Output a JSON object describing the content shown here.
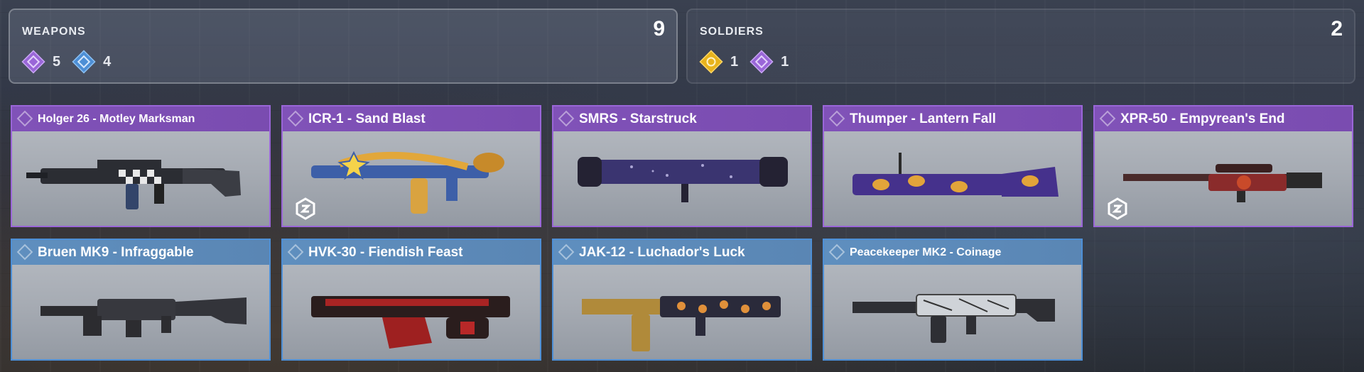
{
  "weapons": {
    "title": "WEAPONS",
    "total": "9",
    "counts": [
      {
        "icon": "epic-rarity-icon",
        "value": "5",
        "color": "#9a66d8"
      },
      {
        "icon": "rare-rarity-icon",
        "value": "4",
        "color": "#4d8fd6"
      }
    ]
  },
  "soldiers": {
    "title": "SOLDIERS",
    "total": "2",
    "counts": [
      {
        "icon": "legendary-rarity-icon",
        "value": "1",
        "color": "#e8b31c"
      },
      {
        "icon": "epic-rarity-icon",
        "value": "1",
        "color": "#9a66d8"
      }
    ]
  },
  "items": [
    {
      "name": "Holger 26 - Motley Marksman",
      "rarity": "epic",
      "badge": false,
      "icon": "assault-rifle-icon"
    },
    {
      "name": "ICR-1 - Sand Blast",
      "rarity": "epic",
      "badge": true,
      "icon": "assault-rifle-icon"
    },
    {
      "name": "SMRS - Starstruck",
      "rarity": "epic",
      "badge": false,
      "icon": "launcher-icon"
    },
    {
      "name": "Thumper - Lantern Fall",
      "rarity": "epic",
      "badge": false,
      "icon": "grenade-launcher-icon"
    },
    {
      "name": "XPR-50 - Empyrean's End",
      "rarity": "epic",
      "badge": true,
      "icon": "sniper-rifle-icon"
    },
    {
      "name": "Bruen MK9 - Infraggable",
      "rarity": "rare",
      "badge": false,
      "icon": "lmg-icon"
    },
    {
      "name": "HVK-30 - Fiendish Feast",
      "rarity": "rare",
      "badge": false,
      "icon": "assault-rifle-icon"
    },
    {
      "name": "JAK-12 - Luchador's Luck",
      "rarity": "rare",
      "badge": false,
      "icon": "shotgun-icon"
    },
    {
      "name": "Peacekeeper MK2 - Coinage",
      "rarity": "rare",
      "badge": false,
      "icon": "assault-rifle-icon"
    }
  ],
  "colors": {
    "epic": "#9a66d8",
    "rare": "#4d8fd6",
    "legendary": "#e8b31c"
  }
}
